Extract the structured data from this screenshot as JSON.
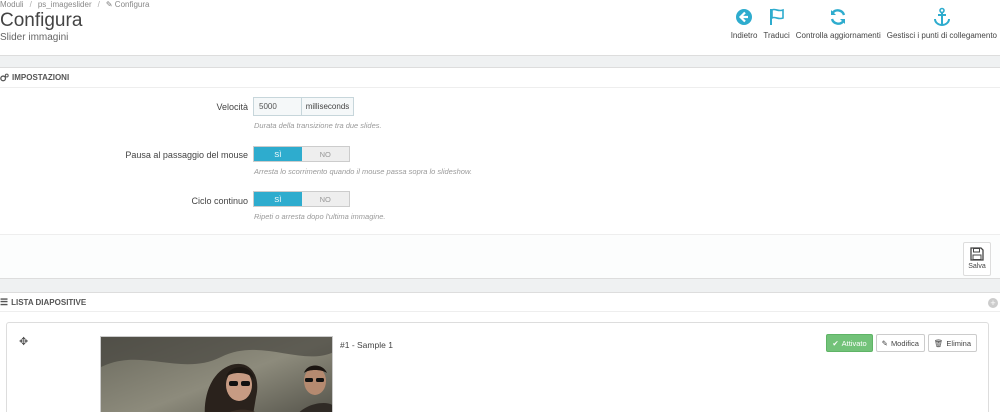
{
  "breadcrumb": {
    "items": [
      "Moduli",
      "ps_imageslider",
      "Configura"
    ]
  },
  "page": {
    "title": "Configura",
    "subtitle": "Slider immagini"
  },
  "toolbar": {
    "back": "Indietro",
    "translate": "Traduci",
    "check_updates": "Controlla aggiornamenti",
    "hooks": "Gestisci i punti di collegamento"
  },
  "settings": {
    "heading": "IMPOSTAZIONI",
    "speed": {
      "label": "Velocità",
      "value": "5000",
      "unit": "milliseconds",
      "help": "Durata della transizione tra due slides."
    },
    "pause": {
      "label": "Pausa al passaggio del mouse",
      "yes": "SÌ",
      "no": "NO",
      "help": "Arresta lo scorrimento quando il mouse passa sopra lo slideshow."
    },
    "loop": {
      "label": "Ciclo continuo",
      "yes": "SÌ",
      "no": "NO",
      "help": "Ripeti o arresta dopo l'ultima immagine."
    },
    "save": "Salva"
  },
  "slides": {
    "heading": "LISTA DIAPOSITIVE",
    "items": [
      {
        "title": "#1 - Sample 1",
        "enabled_label": "Attivato",
        "edit_label": "Modifica",
        "delete_label": "Elimina"
      }
    ]
  },
  "colors": {
    "accent": "#2eacce",
    "success": "#72c279"
  }
}
